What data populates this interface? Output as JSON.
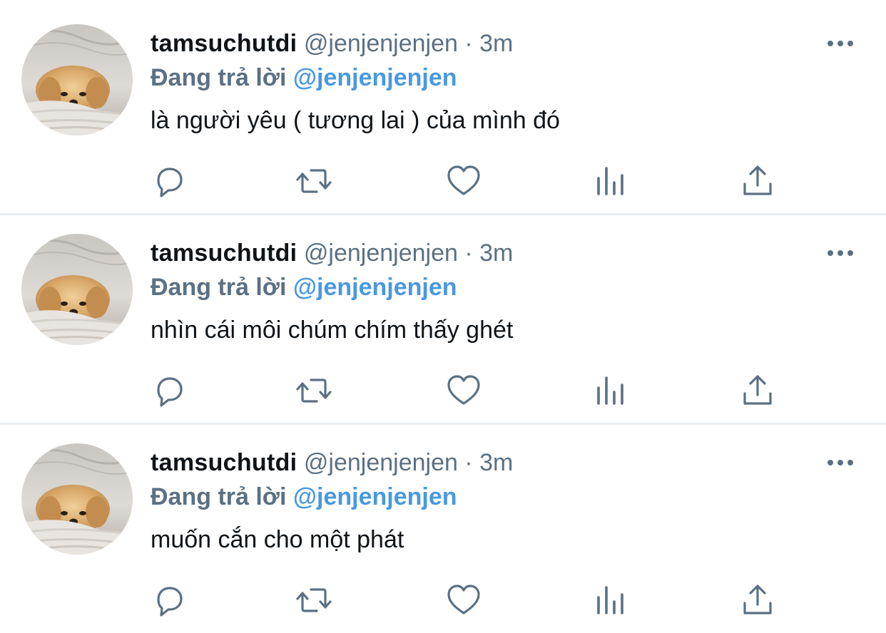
{
  "colors": {
    "text_primary": "#0f1419",
    "text_secondary": "#5b7083",
    "mention": "#4a98e0",
    "divider": "#e7ecf0",
    "icon": "#5b7083"
  },
  "icons": {
    "more": "more-dots-icon",
    "reply": "reply-bubble-icon",
    "retweet": "retweet-icon",
    "like": "heart-icon",
    "stats": "analytics-bars-icon",
    "share": "share-upload-icon"
  },
  "tweets": [
    {
      "display_name": "tamsuchutdi",
      "handle": "@jenjenjenjen",
      "separator": "·",
      "time": "3m",
      "replying_prefix": "Đang trả lời",
      "replying_mention": "@jenjenjenjen",
      "text": "là người yêu ( tương lai ) của mình đó"
    },
    {
      "display_name": "tamsuchutdi",
      "handle": "@jenjenjenjen",
      "separator": "·",
      "time": "3m",
      "replying_prefix": "Đang trả lời",
      "replying_mention": "@jenjenjenjen",
      "text": "nhìn cái môi chúm chím thấy ghét"
    },
    {
      "display_name": "tamsuchutdi",
      "handle": "@jenjenjenjen",
      "separator": "·",
      "time": "3m",
      "replying_prefix": "Đang trả lời",
      "replying_mention": "@jenjenjenjen",
      "text": "muốn cắn cho một phát"
    }
  ]
}
